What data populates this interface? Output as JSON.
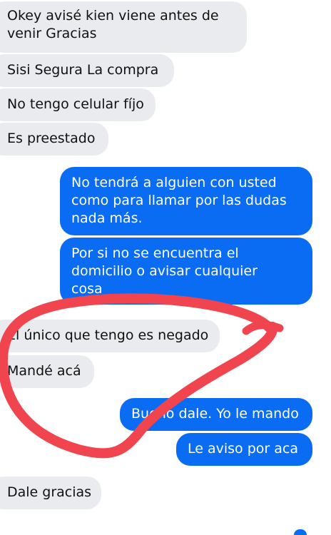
{
  "conversation": {
    "messages": [
      {
        "side": "received",
        "text": "Okey avisé kien viene antes de\nvenir Gracias"
      },
      {
        "side": "received",
        "text": "Sisi Segura La compra"
      },
      {
        "side": "received",
        "text": "No tengo celular fíjo"
      },
      {
        "side": "received",
        "text": "Es preestado"
      },
      {
        "side": "sent",
        "text": "No tendrá a alguien con usted\ncomo para llamar por las dudas\nnada más."
      },
      {
        "side": "sent",
        "text": "Por si no se encuentra el\ndomicilio o avisar cualquier\ncosa"
      },
      {
        "side": "received",
        "text": "El único que tengo es negado"
      },
      {
        "side": "received",
        "text": "Mandé acá"
      },
      {
        "side": "sent",
        "text": "Bueno dale. Yo le mando"
      },
      {
        "side": "sent",
        "text": "Le aviso por aca"
      },
      {
        "side": "received",
        "text": "Dale gracias"
      }
    ]
  },
  "colors": {
    "sent_bubble": "#0a6cf2",
    "received_bubble": "#eaebef",
    "annotation_circle": "#f0454f"
  }
}
